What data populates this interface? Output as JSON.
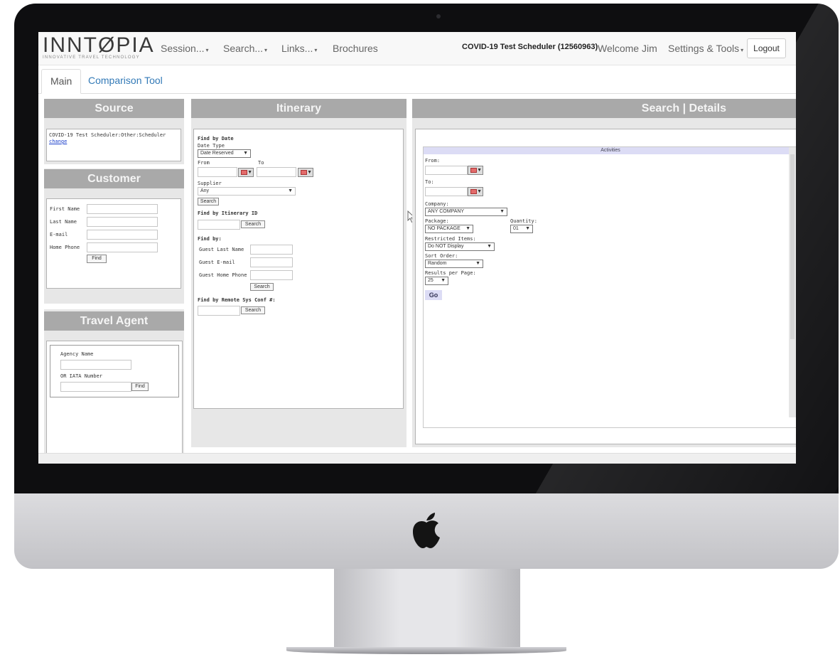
{
  "nav": {
    "brand": "INNTØPIA",
    "brand_tagline": "INNOVATIVE TRAVEL TECHNOLOGY",
    "session": "Session...",
    "search": "Search...",
    "links": "Links...",
    "brochures": "Brochures",
    "account": "COVID-19 Test Scheduler (12560963)",
    "welcome": "Welcome Jim",
    "settings": "Settings & Tools",
    "logout": "Logout",
    "caret": "▾"
  },
  "tabs": {
    "main": "Main",
    "comparison": "Comparison Tool"
  },
  "source": {
    "title": "Source",
    "text": "COVID-19 Test Scheduler:Other:Scheduler",
    "change_link": "change"
  },
  "customer": {
    "title": "Customer",
    "first_name": "First Name",
    "last_name": "Last Name",
    "email": "E-mail",
    "home_phone": "Home Phone",
    "find": "Find"
  },
  "travel_agent": {
    "title": "Travel Agent",
    "agency_name": "Agency Name",
    "iata": "OR IATA Number",
    "find": "Find"
  },
  "itinerary": {
    "title": "Itinerary",
    "find_by_date": "Find by Date",
    "date_type": "Date Type",
    "date_type_value": "Date Reserved",
    "from": "From",
    "to": "To",
    "supplier": "Supplier",
    "supplier_value": "Any",
    "search": "Search",
    "find_by_id": "Find by Itinerary ID",
    "find_by": "Find by:",
    "guest_last_name": "Guest Last Name",
    "guest_email": "Guest E-mail",
    "guest_home_phone": "Guest Home Phone",
    "find_by_remote": "Find by Remote Sys Conf #:"
  },
  "details": {
    "title": "Search | Details",
    "activities": "Activities",
    "from": "From:",
    "to": "To:",
    "company": "Company:",
    "company_value": "ANY COMPANY",
    "package": "Package:",
    "package_value": "NO PACKAGE",
    "quantity": "Quantity:",
    "quantity_value": "01",
    "restricted": "Restricted Items:",
    "restricted_value": "Do NOT Display",
    "sort": "Sort Order:",
    "sort_value": "Random",
    "results": "Results per Page:",
    "results_value": "25",
    "go": "Go"
  },
  "icons": {
    "dropdown": "▼",
    "apple": "apple-logo-icon",
    "calendar": "calendar-icon",
    "cursor": "mouse-pointer-icon"
  },
  "colors": {
    "panel_header": "#a9a9a9",
    "link": "#337ab7",
    "activities_bar": "#dcdcf5"
  }
}
